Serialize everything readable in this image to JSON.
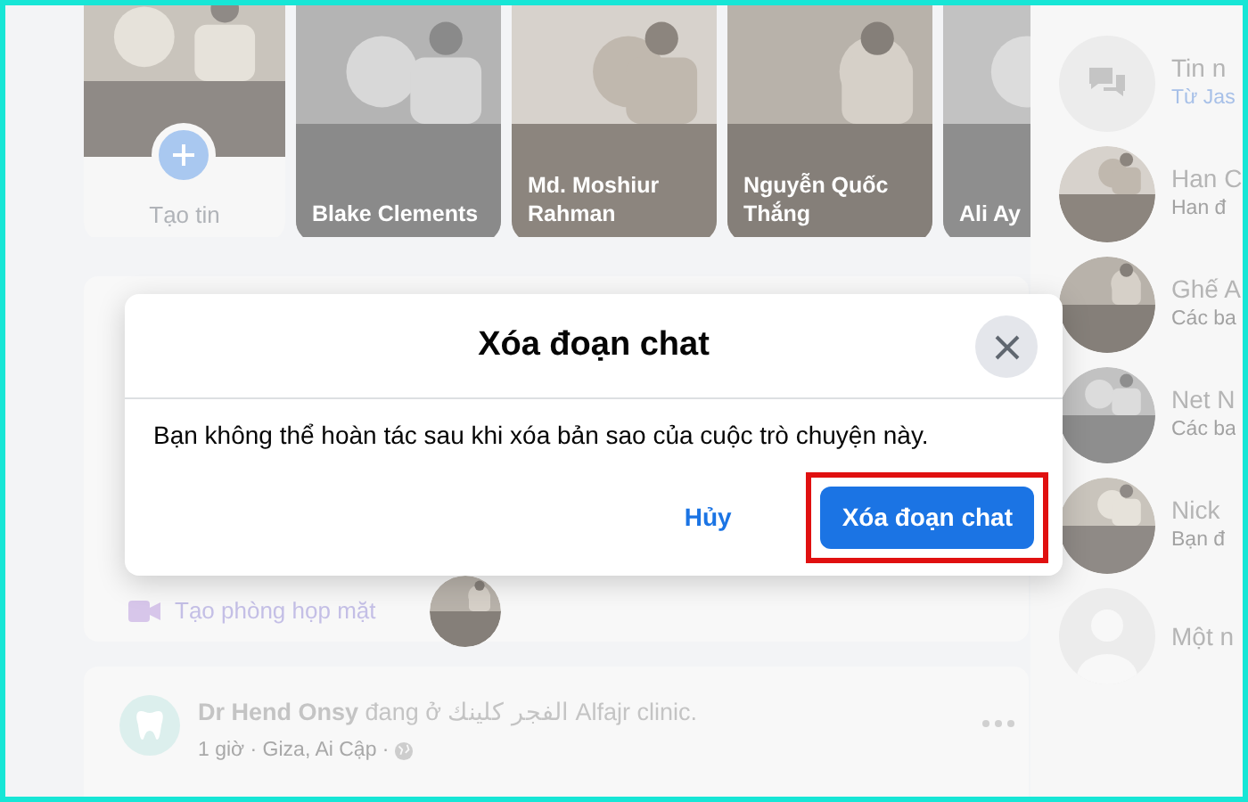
{
  "stories": [
    {
      "kind": "create",
      "label": "Tạo tin"
    },
    {
      "kind": "story",
      "name": "Blake Clements"
    },
    {
      "kind": "story",
      "name": "Md. Moshiur Rahman"
    },
    {
      "kind": "story",
      "name": "Nguyễn Quốc Thắng"
    },
    {
      "kind": "story",
      "name": "Ali Ay"
    }
  ],
  "composer": {
    "room_label": "Tạo phòng họp mặt"
  },
  "post": {
    "author": "Dr Hend Onsy",
    "action": "đang ở",
    "place": "الفجر كلينك Alfajr clinic.",
    "meta": "1 giờ · Giza, Ai Cập ·"
  },
  "sidebar": {
    "items": [
      {
        "kind": "messages",
        "title": "Tin n",
        "subtitle": "Từ Jas"
      },
      {
        "kind": "contact",
        "title": "Han C",
        "subtitle": "Han đ"
      },
      {
        "kind": "contact",
        "title": "Ghế A",
        "subtitle": "Các ba"
      },
      {
        "kind": "contact",
        "title": "Net N",
        "subtitle": "Các ba"
      },
      {
        "kind": "contact",
        "title": "Nick",
        "subtitle": "Bạn đ"
      },
      {
        "kind": "placeholder",
        "title": "Một n"
      }
    ]
  },
  "dialog": {
    "title": "Xóa đoạn chat",
    "message": "Bạn không thể hoàn tác sau khi xóa bản sao của cuộc trò chuyện này.",
    "cancel": "Hủy",
    "confirm": "Xóa đoạn chat",
    "confirm_highlighted": true
  }
}
